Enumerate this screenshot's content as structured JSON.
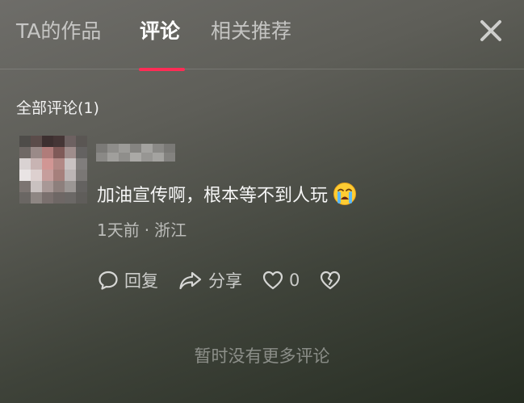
{
  "tabs": [
    {
      "label": "TA的作品",
      "active": false
    },
    {
      "label": "评论",
      "active": true
    },
    {
      "label": "相关推荐",
      "active": false
    }
  ],
  "accent_color": "#fe2c55",
  "close_icon": "close-icon",
  "comments_section": {
    "heading": "全部评论(1)"
  },
  "comment": {
    "avatar": "blurred-avatar",
    "username": "",
    "text": "加油宣传啊，根本等不到人玩",
    "emoji": "loudly-crying-face-emoji",
    "time": "1天前",
    "separator": "·",
    "location": "浙江",
    "actions": {
      "reply_label": "回复",
      "share_label": "分享",
      "like_count": "0",
      "dislike_icon": "broken-heart-icon"
    }
  },
  "footer": {
    "no_more": "暂时没有更多评论"
  }
}
